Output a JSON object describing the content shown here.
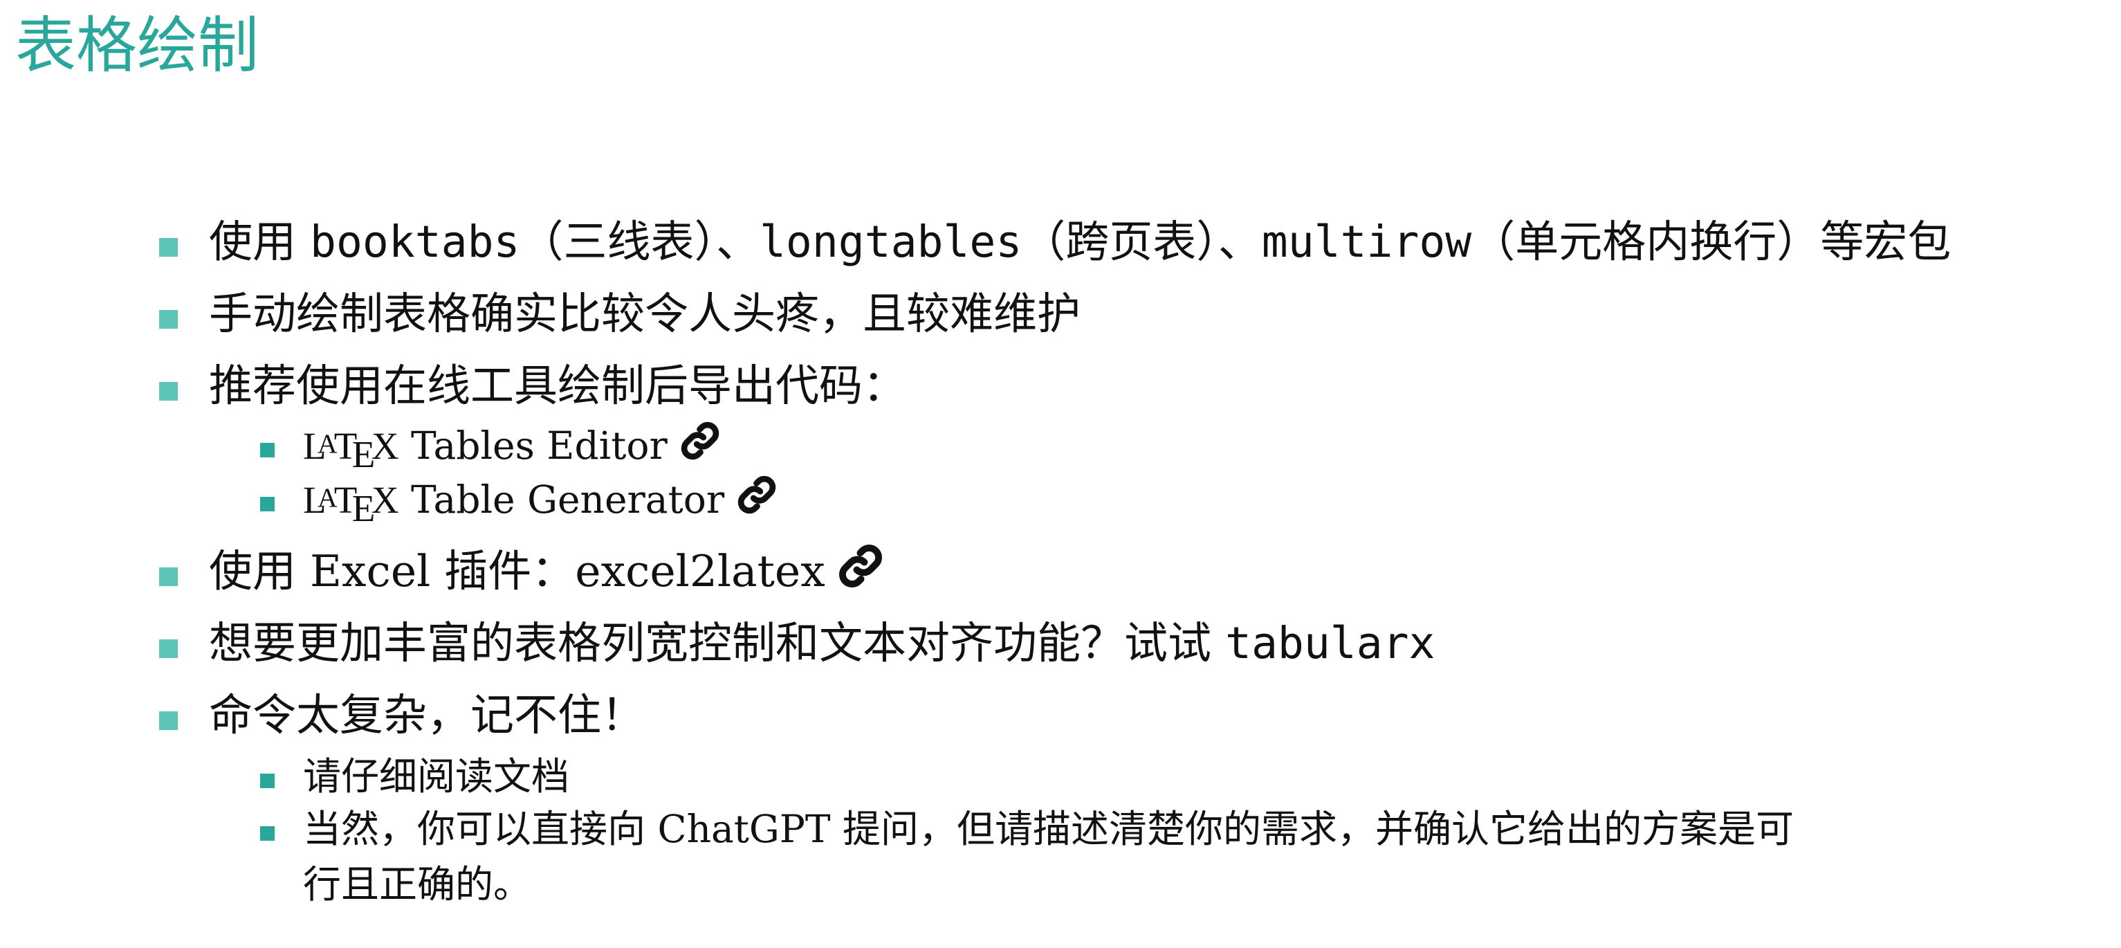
{
  "title": "表格绘制",
  "items": {
    "i1": {
      "t1": "使用 ",
      "m1": "booktabs",
      "t2": "（三线表）、",
      "m2": "longtables",
      "t3": "（跨页表）、",
      "m3": "multirow",
      "t4": "（单元格内换行）等宏包"
    },
    "i2": {
      "text": "手动绘制表格确实比较令人头疼，且较难维护"
    },
    "i3": {
      "text": "推荐使用在线工具绘制后导出代码："
    },
    "i3a": {
      "logo": "LaTeX",
      "text": " Tables Editor"
    },
    "i3b": {
      "logo": "LaTeX",
      "text": " Table Generator"
    },
    "i4": {
      "text": "使用 Excel 插件：excel2latex"
    },
    "i5": {
      "text": "想要更加丰富的表格列宽控制和文本对齐功能？试试 ",
      "mono": "tabularx"
    },
    "i6": {
      "text": "命令太复杂，记不住！"
    },
    "i6a": {
      "text": "请仔细阅读文档"
    },
    "i6b": {
      "line1": "当然，你可以直接向 ChatGPT 提问，但请描述清楚你的需求，并确认它给出的方案是可",
      "line2": "行且正确的。"
    }
  },
  "icons": {
    "link": "link-icon",
    "bullet": "square-bullet"
  },
  "colors": {
    "title": "#2aa79b",
    "bullet_level1": "#5fc4b8",
    "bullet_level2": "#2aa79b"
  }
}
